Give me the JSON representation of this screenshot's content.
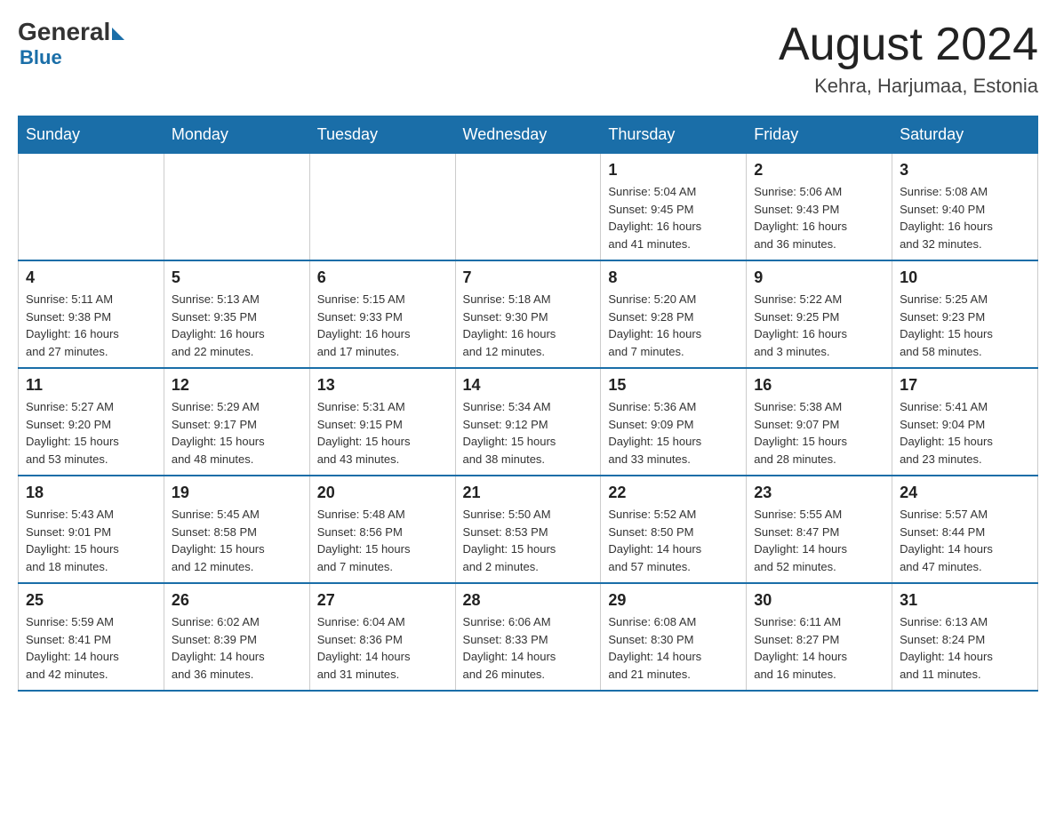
{
  "header": {
    "logo_general": "General",
    "logo_blue": "Blue",
    "month_title": "August 2024",
    "location": "Kehra, Harjumaa, Estonia"
  },
  "days_of_week": [
    "Sunday",
    "Monday",
    "Tuesday",
    "Wednesday",
    "Thursday",
    "Friday",
    "Saturday"
  ],
  "weeks": [
    [
      {
        "day": "",
        "info": ""
      },
      {
        "day": "",
        "info": ""
      },
      {
        "day": "",
        "info": ""
      },
      {
        "day": "",
        "info": ""
      },
      {
        "day": "1",
        "info": "Sunrise: 5:04 AM\nSunset: 9:45 PM\nDaylight: 16 hours\nand 41 minutes."
      },
      {
        "day": "2",
        "info": "Sunrise: 5:06 AM\nSunset: 9:43 PM\nDaylight: 16 hours\nand 36 minutes."
      },
      {
        "day": "3",
        "info": "Sunrise: 5:08 AM\nSunset: 9:40 PM\nDaylight: 16 hours\nand 32 minutes."
      }
    ],
    [
      {
        "day": "4",
        "info": "Sunrise: 5:11 AM\nSunset: 9:38 PM\nDaylight: 16 hours\nand 27 minutes."
      },
      {
        "day": "5",
        "info": "Sunrise: 5:13 AM\nSunset: 9:35 PM\nDaylight: 16 hours\nand 22 minutes."
      },
      {
        "day": "6",
        "info": "Sunrise: 5:15 AM\nSunset: 9:33 PM\nDaylight: 16 hours\nand 17 minutes."
      },
      {
        "day": "7",
        "info": "Sunrise: 5:18 AM\nSunset: 9:30 PM\nDaylight: 16 hours\nand 12 minutes."
      },
      {
        "day": "8",
        "info": "Sunrise: 5:20 AM\nSunset: 9:28 PM\nDaylight: 16 hours\nand 7 minutes."
      },
      {
        "day": "9",
        "info": "Sunrise: 5:22 AM\nSunset: 9:25 PM\nDaylight: 16 hours\nand 3 minutes."
      },
      {
        "day": "10",
        "info": "Sunrise: 5:25 AM\nSunset: 9:23 PM\nDaylight: 15 hours\nand 58 minutes."
      }
    ],
    [
      {
        "day": "11",
        "info": "Sunrise: 5:27 AM\nSunset: 9:20 PM\nDaylight: 15 hours\nand 53 minutes."
      },
      {
        "day": "12",
        "info": "Sunrise: 5:29 AM\nSunset: 9:17 PM\nDaylight: 15 hours\nand 48 minutes."
      },
      {
        "day": "13",
        "info": "Sunrise: 5:31 AM\nSunset: 9:15 PM\nDaylight: 15 hours\nand 43 minutes."
      },
      {
        "day": "14",
        "info": "Sunrise: 5:34 AM\nSunset: 9:12 PM\nDaylight: 15 hours\nand 38 minutes."
      },
      {
        "day": "15",
        "info": "Sunrise: 5:36 AM\nSunset: 9:09 PM\nDaylight: 15 hours\nand 33 minutes."
      },
      {
        "day": "16",
        "info": "Sunrise: 5:38 AM\nSunset: 9:07 PM\nDaylight: 15 hours\nand 28 minutes."
      },
      {
        "day": "17",
        "info": "Sunrise: 5:41 AM\nSunset: 9:04 PM\nDaylight: 15 hours\nand 23 minutes."
      }
    ],
    [
      {
        "day": "18",
        "info": "Sunrise: 5:43 AM\nSunset: 9:01 PM\nDaylight: 15 hours\nand 18 minutes."
      },
      {
        "day": "19",
        "info": "Sunrise: 5:45 AM\nSunset: 8:58 PM\nDaylight: 15 hours\nand 12 minutes."
      },
      {
        "day": "20",
        "info": "Sunrise: 5:48 AM\nSunset: 8:56 PM\nDaylight: 15 hours\nand 7 minutes."
      },
      {
        "day": "21",
        "info": "Sunrise: 5:50 AM\nSunset: 8:53 PM\nDaylight: 15 hours\nand 2 minutes."
      },
      {
        "day": "22",
        "info": "Sunrise: 5:52 AM\nSunset: 8:50 PM\nDaylight: 14 hours\nand 57 minutes."
      },
      {
        "day": "23",
        "info": "Sunrise: 5:55 AM\nSunset: 8:47 PM\nDaylight: 14 hours\nand 52 minutes."
      },
      {
        "day": "24",
        "info": "Sunrise: 5:57 AM\nSunset: 8:44 PM\nDaylight: 14 hours\nand 47 minutes."
      }
    ],
    [
      {
        "day": "25",
        "info": "Sunrise: 5:59 AM\nSunset: 8:41 PM\nDaylight: 14 hours\nand 42 minutes."
      },
      {
        "day": "26",
        "info": "Sunrise: 6:02 AM\nSunset: 8:39 PM\nDaylight: 14 hours\nand 36 minutes."
      },
      {
        "day": "27",
        "info": "Sunrise: 6:04 AM\nSunset: 8:36 PM\nDaylight: 14 hours\nand 31 minutes."
      },
      {
        "day": "28",
        "info": "Sunrise: 6:06 AM\nSunset: 8:33 PM\nDaylight: 14 hours\nand 26 minutes."
      },
      {
        "day": "29",
        "info": "Sunrise: 6:08 AM\nSunset: 8:30 PM\nDaylight: 14 hours\nand 21 minutes."
      },
      {
        "day": "30",
        "info": "Sunrise: 6:11 AM\nSunset: 8:27 PM\nDaylight: 14 hours\nand 16 minutes."
      },
      {
        "day": "31",
        "info": "Sunrise: 6:13 AM\nSunset: 8:24 PM\nDaylight: 14 hours\nand 11 minutes."
      }
    ]
  ]
}
